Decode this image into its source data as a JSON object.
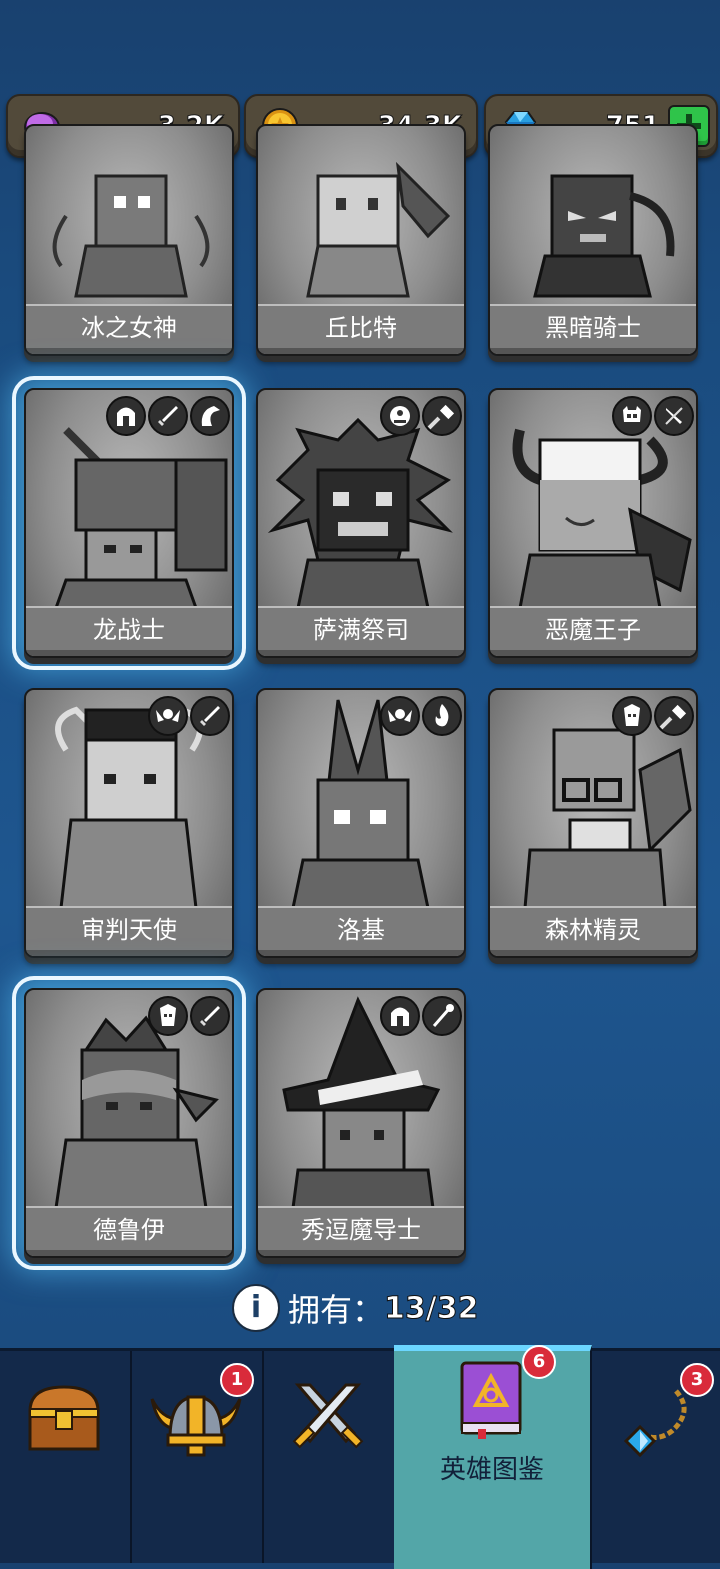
{
  "currencies": [
    {
      "name": "purple-gem",
      "value": "3.2K",
      "color": "#b45ad8"
    },
    {
      "name": "gold-coin",
      "value": "34.3K",
      "color": "#f3b91e"
    },
    {
      "name": "diamond",
      "value": "751",
      "color": "#32b8ef"
    }
  ],
  "heroes": [
    {
      "name": "冰之女神",
      "badges": [],
      "selected": false
    },
    {
      "name": "丘比特",
      "badges": [],
      "selected": false
    },
    {
      "name": "黑暗骑士",
      "badges": [],
      "selected": false
    },
    {
      "name": "龙战士",
      "badges": [
        "helmet-icon",
        "sword-icon",
        "dragon-icon"
      ],
      "selected": true
    },
    {
      "name": "萨满祭司",
      "badges": [
        "orc-icon",
        "hammer-icon"
      ],
      "selected": false
    },
    {
      "name": "恶魔王子",
      "badges": [
        "demon-skull-icon",
        "dagger-icon"
      ],
      "selected": false
    },
    {
      "name": "审判天使",
      "badges": [
        "angel-wings-icon",
        "sword-icon"
      ],
      "selected": false
    },
    {
      "name": "洛基",
      "badges": [
        "angel-wings-icon",
        "fire-icon"
      ],
      "selected": false
    },
    {
      "name": "森林精灵",
      "badges": [
        "elf-icon",
        "hammer-icon"
      ],
      "selected": false
    },
    {
      "name": "德鲁伊",
      "badges": [
        "elf-icon",
        "sword-icon"
      ],
      "selected": true
    },
    {
      "name": "秀逗魔导士",
      "badges": [
        "helmet-icon",
        "staff-icon"
      ],
      "selected": false
    }
  ],
  "owned": {
    "label": "拥有：",
    "count": "13/32"
  },
  "nav": {
    "items": [
      {
        "icon": "treasure-chest-icon",
        "badge": ""
      },
      {
        "icon": "viking-helmet-icon",
        "badge": "1"
      },
      {
        "icon": "crossed-swords-icon",
        "badge": ""
      },
      {
        "icon": "spellbook-icon",
        "label": "英雄图鉴",
        "badge": "6",
        "active": true
      },
      {
        "icon": "amulet-icon",
        "badge": "3"
      }
    ]
  }
}
